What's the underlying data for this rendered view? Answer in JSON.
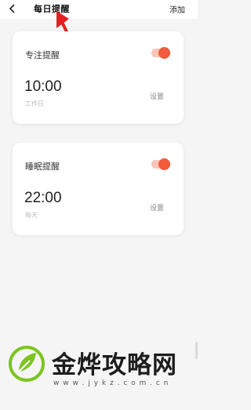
{
  "header": {
    "title": "每日提醒",
    "add_label": "添加",
    "back_icon": "chevron-left-icon"
  },
  "reminders": [
    {
      "title": "专注提醒",
      "time": "10:00",
      "repeat": "工作日",
      "set_label": "设置",
      "enabled": true
    },
    {
      "title": "睡眠提醒",
      "time": "22:00",
      "repeat": "每天",
      "set_label": "设置",
      "enabled": true
    }
  ],
  "colors": {
    "accent": "#f15a3a",
    "toggle_track": "#f9c3b8",
    "annotation_arrow": "#e02020",
    "watermark_green": "#7cc520"
  },
  "watermark": {
    "text": "金烨攻略网",
    "url": "w w w . j y k z . c o m . c n"
  }
}
